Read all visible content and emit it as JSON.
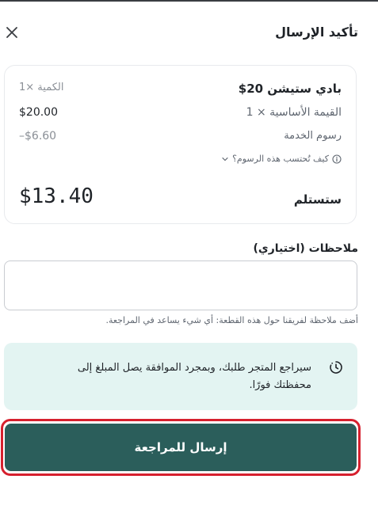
{
  "header": {
    "title": "تأكيد الإرسال"
  },
  "summary": {
    "product_name": "بادي ستيشن 20$",
    "quantity": "الكمية ×1",
    "base_label": "القيمة الأساسية × 1",
    "base_value": "$20.00",
    "fee_label": "رسوم الخدمة",
    "fee_value": "–$6.60",
    "how_calculated": "كيف تُحتسب هذه الرسوم؟",
    "receive_label": "ستستلم",
    "receive_value": "$13.40"
  },
  "notes": {
    "label": "ملاحظات (اختياري)",
    "value": "",
    "placeholder": "",
    "hint": "أضف ملاحظة لفريقنا حول هذه القطعة: أي شيء يساعد في المراجعة."
  },
  "info": {
    "text": "سيراجع المتجر طلبك، وبمجرد الموافقة يصل المبلغ إلى محفظتك فورًا."
  },
  "actions": {
    "submit_label": "إرسال للمراجعة"
  },
  "colors": {
    "accent": "#2b5e5b",
    "info_bg": "#e3f4f2",
    "highlight": "#d6202e"
  },
  "icons": {
    "close": "close-icon",
    "info": "info-icon",
    "chevron": "chevron-down-icon",
    "clock": "clock-check-icon"
  }
}
